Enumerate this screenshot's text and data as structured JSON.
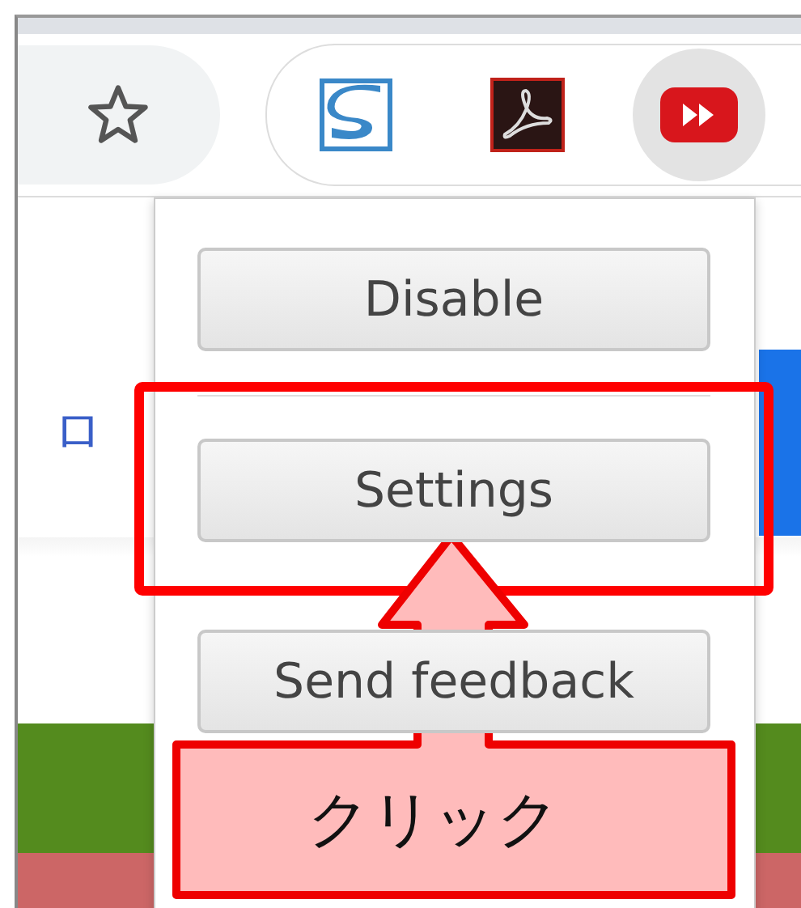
{
  "toolbar": {
    "extensions": [
      {
        "kind": "s-logo",
        "selected": false
      },
      {
        "kind": "pdf-logo",
        "selected": false
      },
      {
        "kind": "play-logo",
        "selected": true
      }
    ]
  },
  "page": {
    "link_text": "ロ"
  },
  "popup": {
    "buttons": [
      {
        "label": "Disable"
      },
      {
        "label": "Settings"
      },
      {
        "label": "Send feedback"
      }
    ]
  },
  "callout": {
    "text": "クリック"
  }
}
